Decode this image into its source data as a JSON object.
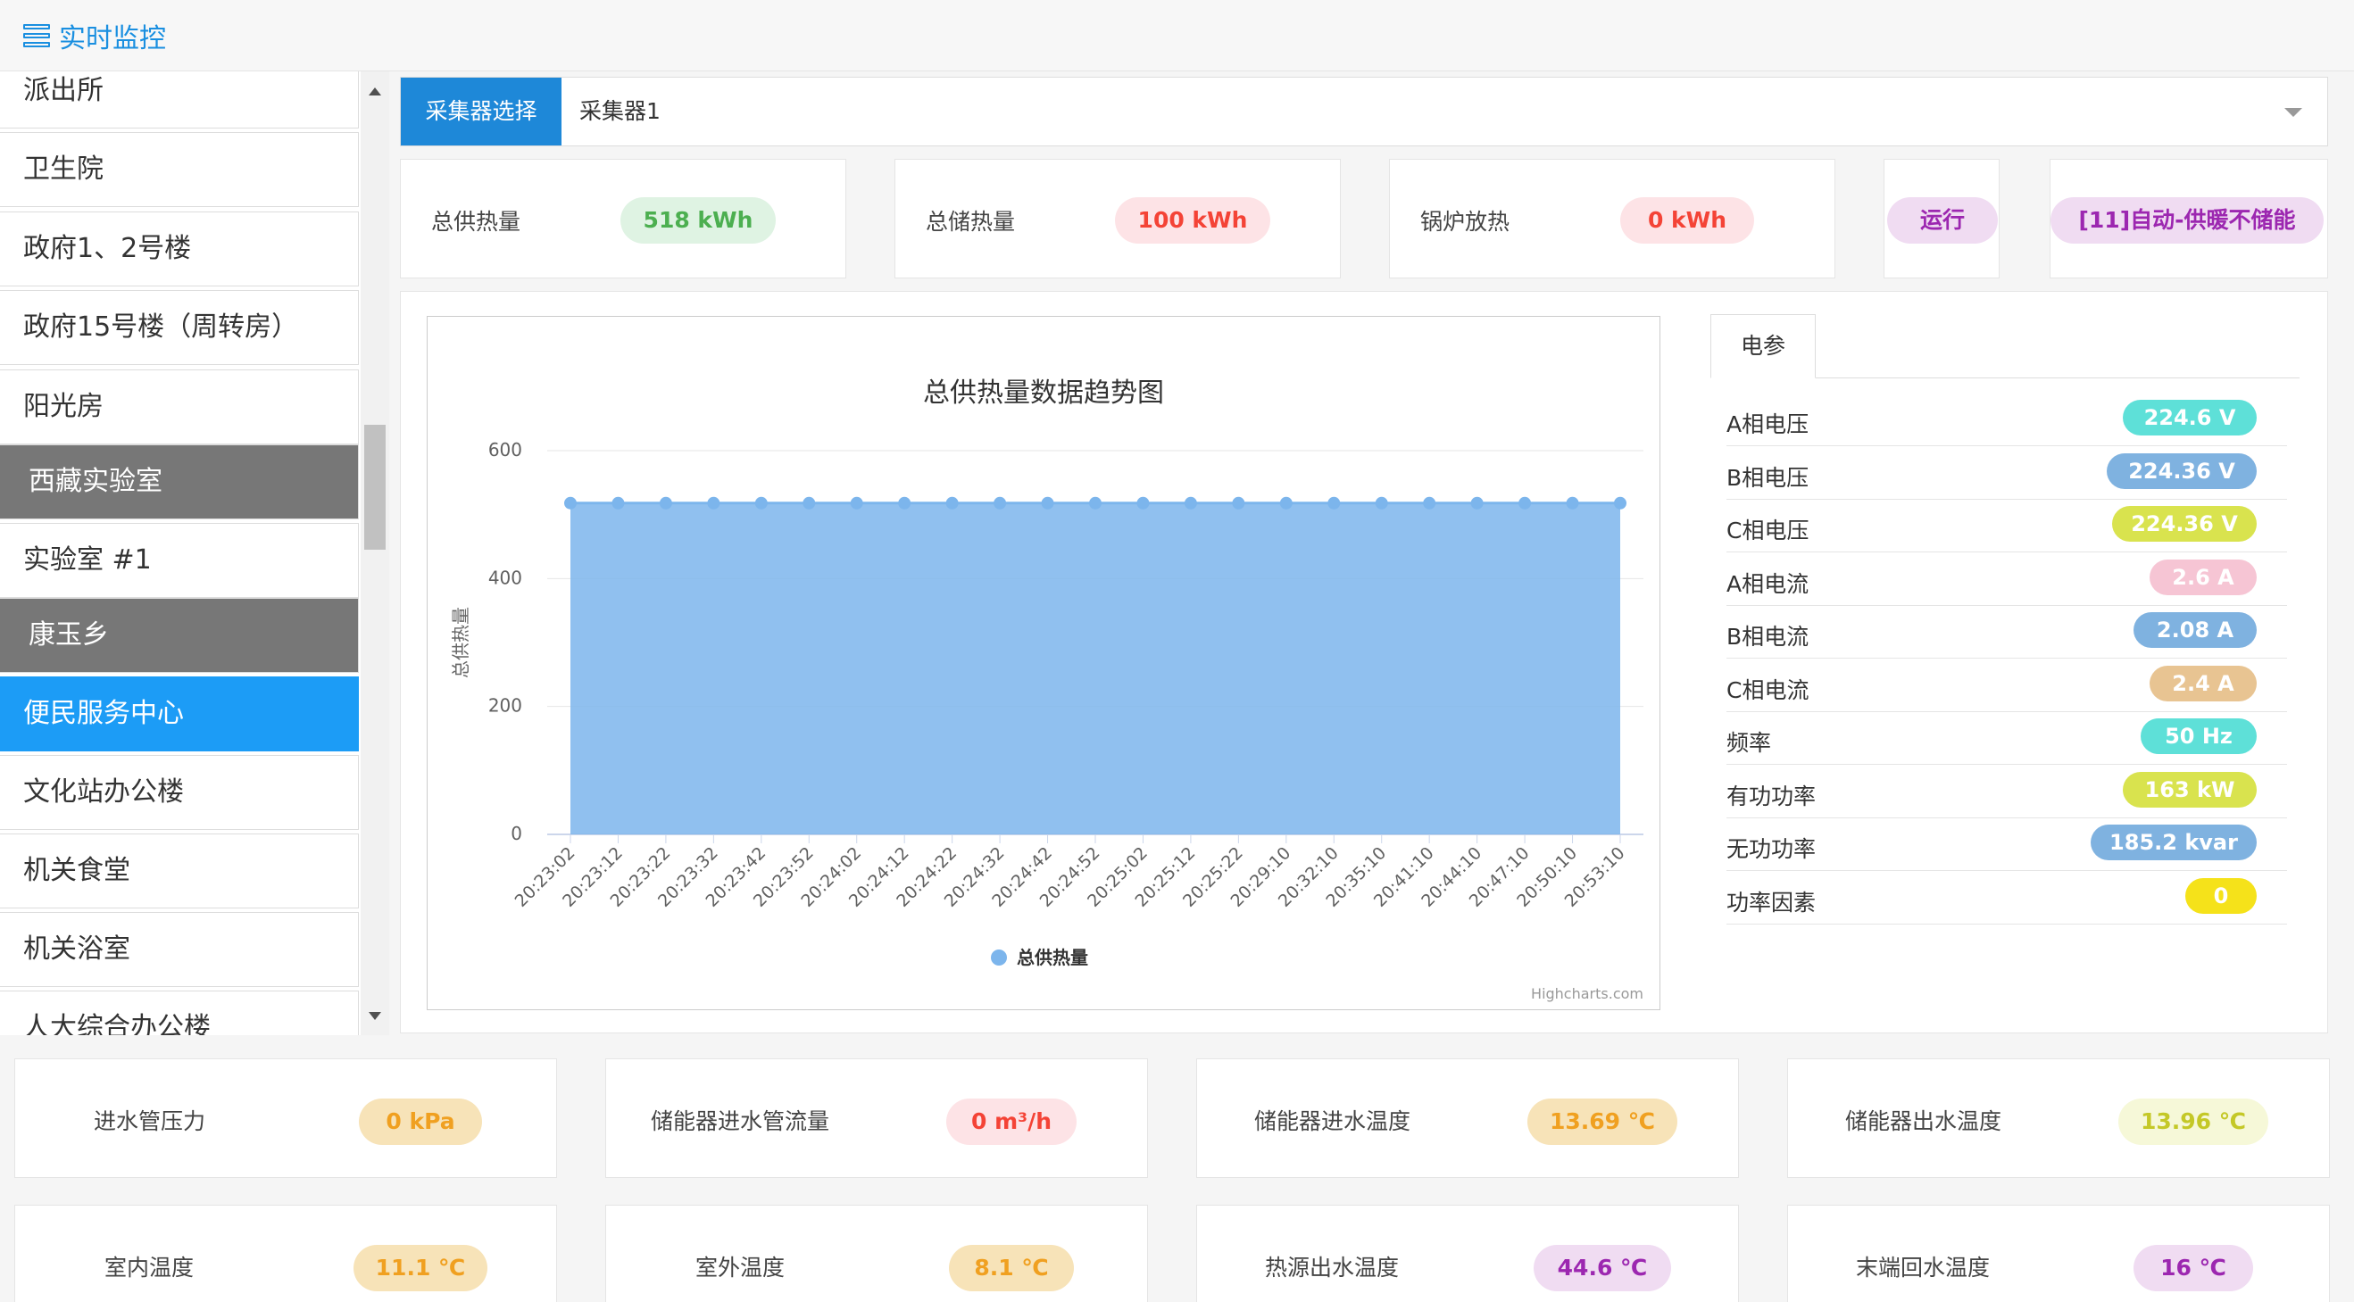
{
  "header": {
    "title": "实时监控",
    "icon": "menu-icon"
  },
  "sidebar": {
    "items": [
      {
        "label": "派出所",
        "state": "normal"
      },
      {
        "label": "卫生院",
        "state": "normal"
      },
      {
        "label": "政府1、2号楼",
        "state": "normal"
      },
      {
        "label": "政府15号楼（周转房）",
        "state": "normal"
      },
      {
        "label": "阳光房",
        "state": "normal"
      },
      {
        "label": "西藏实验室",
        "state": "group"
      },
      {
        "label": "实验室 #1",
        "state": "normal"
      },
      {
        "label": "康玉乡",
        "state": "group"
      },
      {
        "label": "便民服务中心",
        "state": "active"
      },
      {
        "label": "文化站办公楼",
        "state": "normal"
      },
      {
        "label": "机关食堂",
        "state": "normal"
      },
      {
        "label": "机关浴室",
        "state": "normal"
      },
      {
        "label": "人大综合办公楼",
        "state": "normal"
      }
    ]
  },
  "selector": {
    "label": "采集器选择",
    "value": "采集器1"
  },
  "stats": {
    "total_supply": {
      "label": "总供热量",
      "value": "518 kWh"
    },
    "total_storage": {
      "label": "总储热量",
      "value": "100 kWh"
    },
    "boiler": {
      "label": "锅炉放热",
      "value": "0 kWh"
    },
    "status": {
      "value": "运行"
    },
    "mode": {
      "value": "[11]自动-供暖不储能"
    }
  },
  "chart_data": {
    "type": "area",
    "title": "总供热量数据趋势图",
    "xlabel": "",
    "ylabel": "总供热量",
    "ylim": [
      0,
      600
    ],
    "yticks": [
      "0",
      "200",
      "400",
      "600"
    ],
    "grid": true,
    "legend": "bottom-center",
    "credits": "Highcharts.com",
    "categories": [
      "20:23:02",
      "20:23:12",
      "20:23:22",
      "20:23:32",
      "20:23:42",
      "20:23:52",
      "20:24:02",
      "20:24:12",
      "20:24:22",
      "20:24:32",
      "20:24:42",
      "20:24:52",
      "20:25:02",
      "20:25:12",
      "20:25:22",
      "20:29:10",
      "20:32:10",
      "20:35:10",
      "20:41:10",
      "20:44:10",
      "20:47:10",
      "20:50:10",
      "20:53:10"
    ],
    "series": [
      {
        "name": "总供热量",
        "values": [
          518,
          518,
          518,
          518,
          518,
          518,
          518,
          518,
          518,
          518,
          518,
          518,
          518,
          518,
          518,
          518,
          518,
          518,
          518,
          518,
          518,
          518,
          518
        ],
        "color": "#7cb5ec"
      }
    ]
  },
  "electric": {
    "tab": "电参",
    "params": [
      {
        "name": "A相电压",
        "value": "224.6 V",
        "color": "#5ee0d8"
      },
      {
        "name": "B相电压",
        "value": "224.36 V",
        "color": "#7fb2e0"
      },
      {
        "name": "C相电压",
        "value": "224.36 V",
        "color": "#d9e34e"
      },
      {
        "name": "A相电流",
        "value": "2.6 A",
        "color": "#f6c5d4"
      },
      {
        "name": "B相电流",
        "value": "2.08 A",
        "color": "#7fb2e0"
      },
      {
        "name": "C相电流",
        "value": "2.4 A",
        "color": "#e8c492"
      },
      {
        "name": "频率",
        "value": "50 Hz",
        "color": "#5ee0d8"
      },
      {
        "name": "有功功率",
        "value": "163 kW",
        "color": "#d9e34e"
      },
      {
        "name": "无功功率",
        "value": "185.2 kvar",
        "color": "#7fb2e0"
      },
      {
        "name": "功率因素",
        "value": "0",
        "color": "#f5e21a"
      }
    ]
  },
  "sensors": [
    {
      "label": "进水管压力",
      "value": "0 kPa",
      "bg": "#f7e3b8",
      "fg": "#f0a020"
    },
    {
      "label": "储能器进水管流量",
      "value": "0 m³/h",
      "bg": "#fde3e6",
      "fg": "#f44336"
    },
    {
      "label": "储能器进水温度",
      "value": "13.69 ℃",
      "bg": "#f7e3b8",
      "fg": "#f0a020"
    },
    {
      "label": "储能器出水温度",
      "value": "13.96 ℃",
      "bg": "#f6f8d8",
      "fg": "#c4c827"
    },
    {
      "label": "室内温度",
      "value": "11.1 ℃",
      "bg": "#f7e3b8",
      "fg": "#f0a020"
    },
    {
      "label": "室外温度",
      "value": "8.1 ℃",
      "bg": "#f7e3b8",
      "fg": "#f0a020"
    },
    {
      "label": "热源出水温度",
      "value": "44.6 ℃",
      "bg": "#f0dcf2",
      "fg": "#9c27b0"
    },
    {
      "label": "末端回水温度",
      "value": "16 ℃",
      "bg": "#f0dcf2",
      "fg": "#9c27b0"
    }
  ]
}
